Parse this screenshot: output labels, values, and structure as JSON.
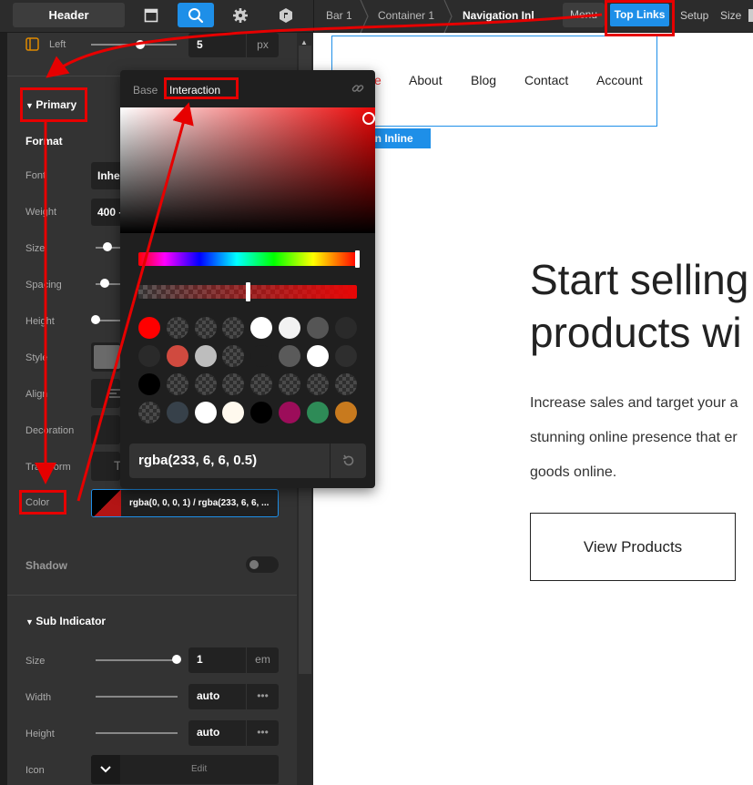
{
  "topbar": {
    "header_button": "Header",
    "breadcrumbs": [
      "Bar 1",
      "Container 1",
      "Navigation Inl"
    ],
    "menu_label": "Menu",
    "top_links_label": "Top Links",
    "tabs": [
      "Setup",
      "Size"
    ]
  },
  "panel": {
    "left_label": "Left",
    "left_value": "5",
    "left_unit": "px",
    "primary_title": "Primary",
    "format_title": "Format",
    "rows": {
      "font": "Font",
      "font_value": "Inhe",
      "weight": "Weight",
      "weight_value": "400 -",
      "size": "Size",
      "spacing": "Spacing",
      "height": "Height",
      "style": "Style",
      "align": "Align",
      "decoration": "Decoration",
      "transform": "Transform",
      "transform_value": "T"
    },
    "color_label": "Color",
    "color_value": "rgba(0, 0, 0, 1) / rgba(233, 6, 6, ...",
    "shadow_label": "Shadow",
    "sub_indicator_title": "Sub Indicator",
    "sub": {
      "size_label": "Size",
      "size_value": "1",
      "size_unit": "em",
      "width_label": "Width",
      "width_value": "auto",
      "height_label": "Height",
      "height_value": "auto",
      "icon_label": "Icon",
      "icon_edit": "Edit",
      "more": "•••"
    }
  },
  "picker": {
    "tab_base": "Base",
    "tab_interaction": "Interaction",
    "value": "rgba(233, 6, 6, 0.5)",
    "selected_color": "#e90606",
    "alpha_fraction": 0.5,
    "swatches": [
      [
        "#ff0000",
        "check",
        "check",
        "check",
        "#ffffff",
        "#f2f2f2",
        "#555555",
        "#2a2a2a"
      ],
      [
        "#2a2a2a",
        "#d04a3f",
        "#bdbdbd",
        "check",
        "#1f1f1f",
        "#5a5a5a",
        "#ffffff",
        "#2e2e2e"
      ],
      [
        "#000000",
        "check",
        "check",
        "check",
        "check",
        "check",
        "check",
        "check"
      ],
      [
        "check",
        "#37414a",
        "#ffffff",
        "#fff9ee",
        "#000000",
        "#9c0d5a",
        "#2e8b57",
        "#c87a1e"
      ]
    ]
  },
  "canvas": {
    "nav_links": [
      "e",
      "About",
      "Blog",
      "Contact",
      "Account"
    ],
    "nav_label": "tion Inline",
    "hero_line1": "Start selling",
    "hero_line2": "products wi",
    "body_line1": "Increase sales and target your a",
    "body_line2": "stunning online presence that er",
    "body_line3": "goods online.",
    "button_label": "View Products"
  },
  "colors": {
    "accent": "#1e8fe8",
    "annotation": "#e60000",
    "panel_bg": "#333333"
  }
}
